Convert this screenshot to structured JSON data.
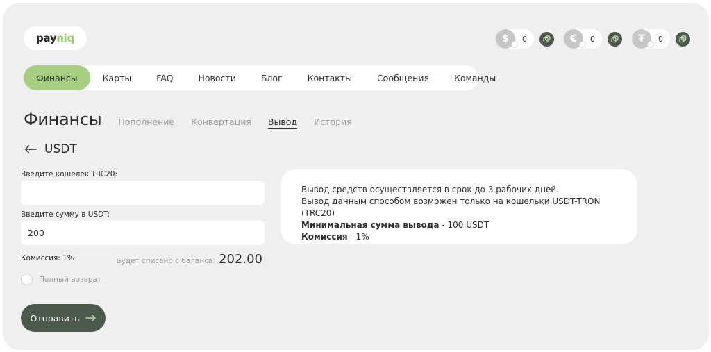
{
  "brand": {
    "logo_part1": "pay",
    "logo_part2": "niq"
  },
  "balances": [
    {
      "currency_symbol": "$",
      "value": "0",
      "icon": "dollar-coin-icon"
    },
    {
      "currency_symbol": "€",
      "value": "0",
      "icon": "euro-coin-icon"
    },
    {
      "currency_symbol": "₮",
      "value": "0",
      "icon": "tether-coin-icon"
    }
  ],
  "nav": {
    "items": [
      {
        "label": "Финансы",
        "active": true
      },
      {
        "label": "Карты"
      },
      {
        "label": "FAQ"
      },
      {
        "label": "Новости"
      },
      {
        "label": "Блог"
      },
      {
        "label": "Контакты"
      },
      {
        "label": "Сообщения"
      },
      {
        "label": "Команды"
      }
    ]
  },
  "page": {
    "title": "Финансы",
    "subtabs": [
      {
        "label": "Пополнение"
      },
      {
        "label": "Конвертация"
      },
      {
        "label": "Вывод",
        "active": true
      },
      {
        "label": "История"
      }
    ],
    "back_title": "USDT"
  },
  "form": {
    "wallet_label": "Введите кошелек TRC20:",
    "wallet_value": "",
    "amount_label": "Введите сумму в USDT:",
    "amount_value": "200",
    "commission": "Комиссия: 1%",
    "debit_label": "Будет списано с баланса:",
    "debit_value": "202.00",
    "refund_label": "Полный возврат",
    "submit_label": "Отправить"
  },
  "info": {
    "line1": "Вывод средств осуществляется в срок до 3 рабочих дней.",
    "line2": "Вывод данным способом возможен только на кошельки USDT-TRON (TRC20)",
    "min_label": "Минимальная сумма вывода",
    "min_value": " - 100 USDT",
    "fee_label": "Комиссия",
    "fee_value": " - 1%"
  },
  "colors": {
    "accent_green": "#a7cf82",
    "dark_green": "#4b5a4c",
    "background": "#efefef"
  }
}
